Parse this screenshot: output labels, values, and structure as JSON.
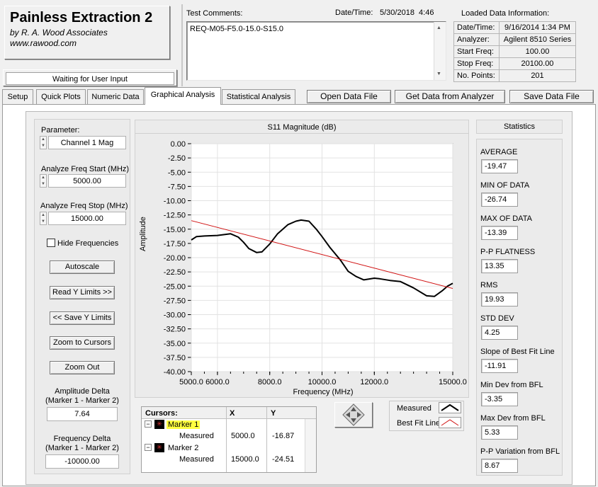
{
  "app": {
    "title": "Painless Extraction 2",
    "company": "by R. A. Wood Associates",
    "website": "www.rawood.com",
    "status": "Waiting for User Input"
  },
  "header": {
    "comments_label": "Test Comments:",
    "comments_value": "REQ-M05-F5.0-15.0-S15.0",
    "datetime_label": "Date/Time:",
    "datetime_value": "5/30/2018  4:46",
    "loaded_label": "Loaded Data Information:",
    "info": [
      {
        "key": "Date/Time:",
        "value": "9/16/2014 1:34 PM"
      },
      {
        "key": "Analyzer:",
        "value": "Agilent 8510 Series"
      },
      {
        "key": "Start Freq:",
        "value": "100.00"
      },
      {
        "key": "Stop Freq:",
        "value": "20100.00"
      },
      {
        "key": "No. Points:",
        "value": "201"
      }
    ]
  },
  "tabs": [
    "Setup",
    "Quick Plots",
    "Numeric Data",
    "Graphical Analysis",
    "Statistical Analysis"
  ],
  "active_tab": "Graphical Analysis",
  "actions": {
    "open": "Open Data File",
    "get": "Get Data from Analyzer",
    "save": "Save Data File"
  },
  "left": {
    "parameter_label": "Parameter:",
    "parameter_value": "Channel 1 Mag",
    "start_label": "Analyze Freq Start (MHz)",
    "start_value": "5000.00",
    "stop_label": "Analyze Freq Stop (MHz)",
    "stop_value": "15000.00",
    "hide_freq": "Hide Frequencies",
    "autoscale": "Autoscale",
    "read_y": "Read Y Limits >>",
    "save_y": "<< Save Y Limits",
    "zoom_cursors": "Zoom to Cursors",
    "zoom_out": "Zoom Out",
    "amp_delta_label1": "Amplitude Delta",
    "amp_delta_label2": "(Marker 1 - Marker 2)",
    "amp_delta_value": "7.64",
    "freq_delta_label1": "Frequency Delta",
    "freq_delta_label2": "(Marker 1 - Marker 2)",
    "freq_delta_value": "-10000.00"
  },
  "cursors": {
    "header": [
      "Cursors:",
      "X",
      "Y"
    ],
    "rows": [
      {
        "name": "Marker 1",
        "sub": "Measured",
        "x": "5000.0",
        "y": "-16.87"
      },
      {
        "name": "Marker 2",
        "sub": "Measured",
        "x": "15000.0",
        "y": "-24.51"
      }
    ]
  },
  "legend": {
    "measured": "Measured",
    "bfl": "Best Fit Line"
  },
  "statistics": {
    "title": "Statistics",
    "items": [
      {
        "label": "AVERAGE",
        "value": "-19.47"
      },
      {
        "label": "MIN OF DATA",
        "value": "-26.74"
      },
      {
        "label": "MAX OF DATA",
        "value": "-13.39"
      },
      {
        "label": "P-P FLATNESS",
        "value": "13.35"
      },
      {
        "label": "RMS",
        "value": "19.93"
      },
      {
        "label": "STD DEV",
        "value": "4.25"
      },
      {
        "label": "Slope of Best Fit Line",
        "value": "-11.91"
      },
      {
        "label": "Min Dev from BFL",
        "value": "-3.35"
      },
      {
        "label": "Max Dev from BFL",
        "value": "5.33"
      },
      {
        "label": "P-P Variation from BFL",
        "value": "8.67"
      }
    ]
  },
  "colors": {
    "measured": "#000000",
    "best_fit": "#d01010",
    "marker_highlight": "#ffff40"
  },
  "chart_data": {
    "type": "line",
    "title": "S11 Magnitude (dB)",
    "xlabel": "Frequency (MHz)",
    "ylabel": "Amplitude",
    "xlim": [
      5000,
      15000
    ],
    "ylim": [
      -40,
      0
    ],
    "x_ticks": [
      "5000.0",
      "6000.0",
      "8000.0",
      "10000.0",
      "12000.0",
      "15000.0"
    ],
    "x_tick_values": [
      5000,
      6000,
      8000,
      10000,
      12000,
      15000
    ],
    "y_ticks": [
      "0.00",
      "-2.50",
      "-5.00",
      "-7.50",
      "-10.00",
      "-12.50",
      "-15.00",
      "-17.50",
      "-20.00",
      "-22.50",
      "-25.00",
      "-27.50",
      "-30.00",
      "-32.50",
      "-35.00",
      "-37.50",
      "-40.00"
    ],
    "grid": true,
    "series": [
      {
        "name": "Measured",
        "x": [
          5000,
          5200,
          5500,
          6000,
          6500,
          6800,
          7000,
          7200,
          7500,
          7700,
          8000,
          8300,
          8700,
          9000,
          9200,
          9500,
          9800,
          10000,
          10300,
          10700,
          11000,
          11300,
          11600,
          12000,
          12200,
          12600,
          13000,
          13500,
          14000,
          14300,
          14600,
          14800,
          15000
        ],
        "y": [
          -16.9,
          -16.3,
          -16.2,
          -16.1,
          -15.8,
          -16.4,
          -17.3,
          -18.4,
          -19.1,
          -19.0,
          -17.6,
          -15.8,
          -14.2,
          -13.6,
          -13.4,
          -13.6,
          -15.1,
          -16.3,
          -18.2,
          -20.4,
          -22.4,
          -23.3,
          -23.9,
          -23.6,
          -23.7,
          -24.0,
          -24.2,
          -25.3,
          -26.7,
          -26.8,
          -25.8,
          -25.0,
          -24.5
        ]
      },
      {
        "name": "Best Fit Line",
        "x": [
          5000,
          15000
        ],
        "y": [
          -13.5,
          -25.4
        ]
      }
    ]
  }
}
